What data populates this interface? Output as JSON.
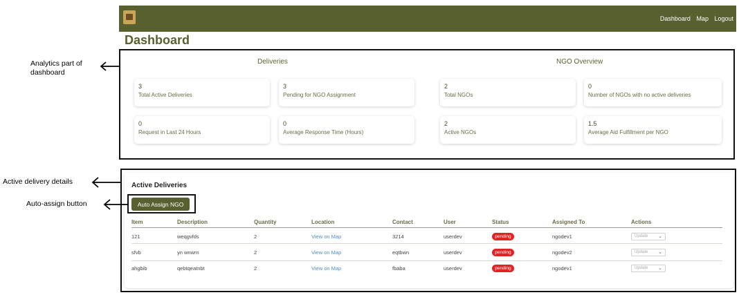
{
  "nav": {
    "links": [
      "Dashboard",
      "Map",
      "Logout"
    ]
  },
  "page_title": "Dashboard",
  "deliveries_section": {
    "heading": "Deliveries",
    "cards": [
      {
        "value": "3",
        "label": "Total Active Deliveries"
      },
      {
        "value": "3",
        "label": "Pending for NGO Assignment"
      },
      {
        "value": "0",
        "label": "Request in Last 24 Hours"
      },
      {
        "value": "0",
        "label": "Average Response Time (Hours)"
      }
    ]
  },
  "ngo_section": {
    "heading": "NGO Overview",
    "cards": [
      {
        "value": "2",
        "label": "Total NGOs"
      },
      {
        "value": "0",
        "label": "Number of NGOs with no active deliveries"
      },
      {
        "value": "2",
        "label": "Active NGOs"
      },
      {
        "value": "1.5",
        "label": "Average Aid Fulfillment per NGO"
      }
    ]
  },
  "active_deliveries": {
    "title": "Active Deliveries",
    "assign_button": "Auto Assign NGO",
    "columns": [
      "Item",
      "Description",
      "Quantity",
      "Location",
      "Contact",
      "User",
      "Status",
      "Assigned To",
      "Actions"
    ],
    "rows": [
      {
        "item": "121",
        "description": "weqgvfds",
        "quantity": "2",
        "location": "View on Map",
        "contact": "3214",
        "user": "userdev",
        "status": "pending",
        "assigned_to": "ngodev1",
        "action": "Update"
      },
      {
        "item": "sfvb",
        "description": "yn wnwrn",
        "quantity": "2",
        "location": "View on Map",
        "contact": "eqtbwn",
        "user": "userdev",
        "status": "pending",
        "assigned_to": "ngodev2",
        "action": "Update"
      },
      {
        "item": "ahgbib",
        "description": "qebtqeatnbt",
        "quantity": "2",
        "location": "View on Map",
        "contact": "fbaba",
        "user": "userdev",
        "status": "pending",
        "assigned_to": "ngodev1",
        "action": "Update"
      }
    ]
  },
  "annotations": {
    "analytics": "Analytics part of dashboard",
    "active_details": "Active delivery details",
    "auto_assign": "Auto-assign button"
  },
  "colors": {
    "brand": "#59602f",
    "status_pending": "#e02424",
    "link": "#4e8cc4"
  }
}
